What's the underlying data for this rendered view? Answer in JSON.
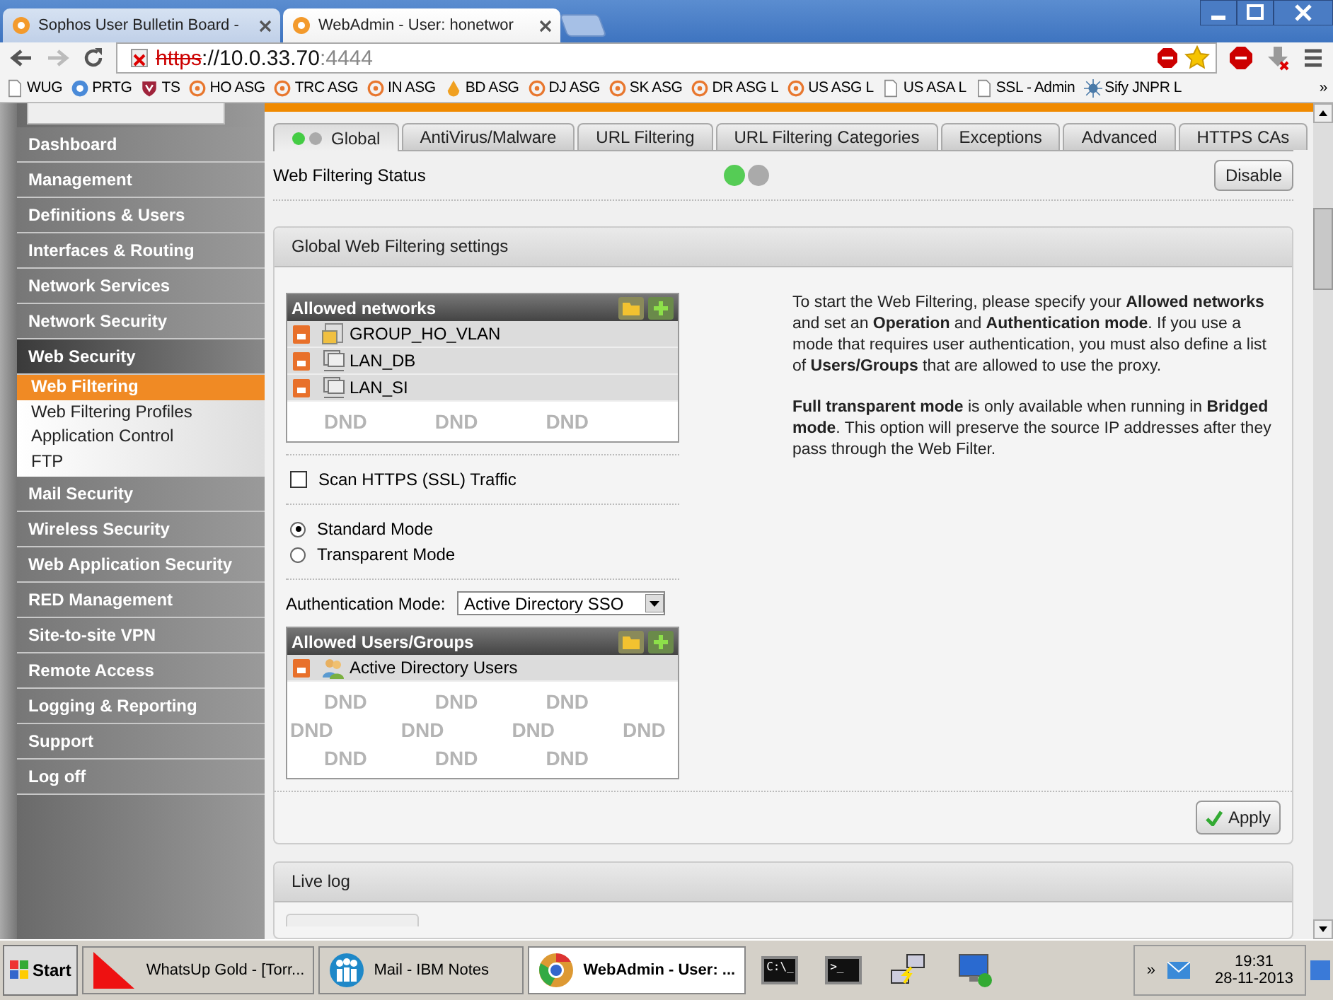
{
  "browser": {
    "tabs": [
      {
        "title": "Sophos User Bulletin Board -",
        "selected": false
      },
      {
        "title": "WebAdmin - User: honetwor",
        "selected": true
      }
    ],
    "address": {
      "scheme": "https",
      "host": "://10.0.33.70",
      "port": ":4444"
    },
    "bookmarks": [
      {
        "label": "WUG",
        "kind": "page"
      },
      {
        "label": "PRTG",
        "kind": "prtg"
      },
      {
        "label": "TS",
        "kind": "shield"
      },
      {
        "label": "HO ASG",
        "kind": "sophos"
      },
      {
        "label": "TRC ASG",
        "kind": "sophos"
      },
      {
        "label": "IN ASG",
        "kind": "sophos"
      },
      {
        "label": "BD ASG",
        "kind": "drop"
      },
      {
        "label": "DJ ASG",
        "kind": "sophos"
      },
      {
        "label": "SK ASG",
        "kind": "sophos"
      },
      {
        "label": "DR ASG L",
        "kind": "sophos"
      },
      {
        "label": "US ASG L",
        "kind": "sophos"
      },
      {
        "label": "US ASA L",
        "kind": "page"
      },
      {
        "label": "SSL - Admin",
        "kind": "page"
      },
      {
        "label": "Sify JNPR L",
        "kind": "star"
      }
    ],
    "more": "»"
  },
  "sidebar": {
    "items": [
      {
        "label": "Dashboard",
        "selected": false
      },
      {
        "label": "Management",
        "selected": false
      },
      {
        "label": "Definitions & Users",
        "selected": false
      },
      {
        "label": "Interfaces & Routing",
        "selected": false
      },
      {
        "label": "Network Services",
        "selected": false
      },
      {
        "label": "Network Security",
        "selected": false
      },
      {
        "label": "Web Security",
        "selected": true,
        "children": [
          {
            "label": "Web Filtering",
            "selected": true
          },
          {
            "label": "Web Filtering Profiles",
            "selected": false
          },
          {
            "label": "Application Control",
            "selected": false
          },
          {
            "label": "FTP",
            "selected": false
          }
        ]
      },
      {
        "label": "Mail Security",
        "selected": false
      },
      {
        "label": "Wireless Security",
        "selected": false
      },
      {
        "label": "Web Application Security",
        "selected": false
      },
      {
        "label": "RED Management",
        "selected": false
      },
      {
        "label": "Site-to-site VPN",
        "selected": false
      },
      {
        "label": "Remote Access",
        "selected": false
      },
      {
        "label": "Logging & Reporting",
        "selected": false
      },
      {
        "label": "Support",
        "selected": false
      },
      {
        "label": "Log off",
        "selected": false
      }
    ]
  },
  "tabs": [
    {
      "label": "Global",
      "selected": true,
      "status": true
    },
    {
      "label": "AntiVirus/Malware",
      "selected": false
    },
    {
      "label": "URL Filtering",
      "selected": false
    },
    {
      "label": "URL Filtering Categories",
      "selected": false
    },
    {
      "label": "Exceptions",
      "selected": false
    },
    {
      "label": "Advanced",
      "selected": false
    },
    {
      "label": "HTTPS CAs",
      "selected": false
    }
  ],
  "status": {
    "label": "Web Filtering Status",
    "on": true,
    "button": "Disable"
  },
  "settings": {
    "title": "Global Web Filtering settings",
    "networks": {
      "title": "Allowed networks",
      "items": [
        {
          "label": "GROUP_HO_VLAN",
          "kind": "group"
        },
        {
          "label": "LAN_DB",
          "kind": "network"
        },
        {
          "label": "LAN_SI",
          "kind": "network"
        }
      ],
      "dnd_rows": [
        [
          "DND",
          "DND",
          "DND"
        ]
      ]
    },
    "scan_https": {
      "label": "Scan HTTPS (SSL) Traffic",
      "checked": false
    },
    "modes": [
      {
        "label": "Standard Mode",
        "selected": true
      },
      {
        "label": "Transparent Mode",
        "selected": false
      }
    ],
    "auth": {
      "label": "Authentication Mode:",
      "value": "Active Directory SSO"
    },
    "users": {
      "title": "Allowed Users/Groups",
      "items": [
        {
          "label": "Active Directory Users",
          "kind": "users"
        }
      ],
      "dnd_rows": [
        [
          "DND",
          "DND",
          "DND"
        ],
        [
          "DND",
          "DND",
          "DND",
          "DND"
        ],
        [
          "DND",
          "DND",
          "DND"
        ]
      ]
    },
    "help": [
      "To start the Web Filtering, please specify your **Allowed networks** and set an **Operation** and **Authentication mode**. If you use a mode that requires user authentication, you must also define a list of **Users/Groups** that are allowed to use the proxy.",
      "**Full transparent mode** is only available when running in **Bridged mode**. This option will preserve the source IP addresses after they pass through the Web Filter."
    ],
    "apply": "Apply"
  },
  "live_log": {
    "title": "Live log"
  },
  "taskbar": {
    "start": "Start",
    "tasks": [
      {
        "label": "WhatsUp Gold - [Torr...",
        "kind": "triangle",
        "selected": false
      },
      {
        "label": "Mail - IBM Notes",
        "kind": "notes",
        "selected": false
      },
      {
        "label": "WebAdmin - User: ...",
        "kind": "chrome",
        "selected": true
      }
    ],
    "quick": [
      {
        "kind": "cmd",
        "label": "C:\\_"
      },
      {
        "kind": "terminal",
        "label": ">_"
      },
      {
        "kind": "putty"
      },
      {
        "kind": "rdp"
      }
    ],
    "tray": {
      "expand": "»",
      "time": "19:31",
      "date": "28-11-2013"
    }
  }
}
